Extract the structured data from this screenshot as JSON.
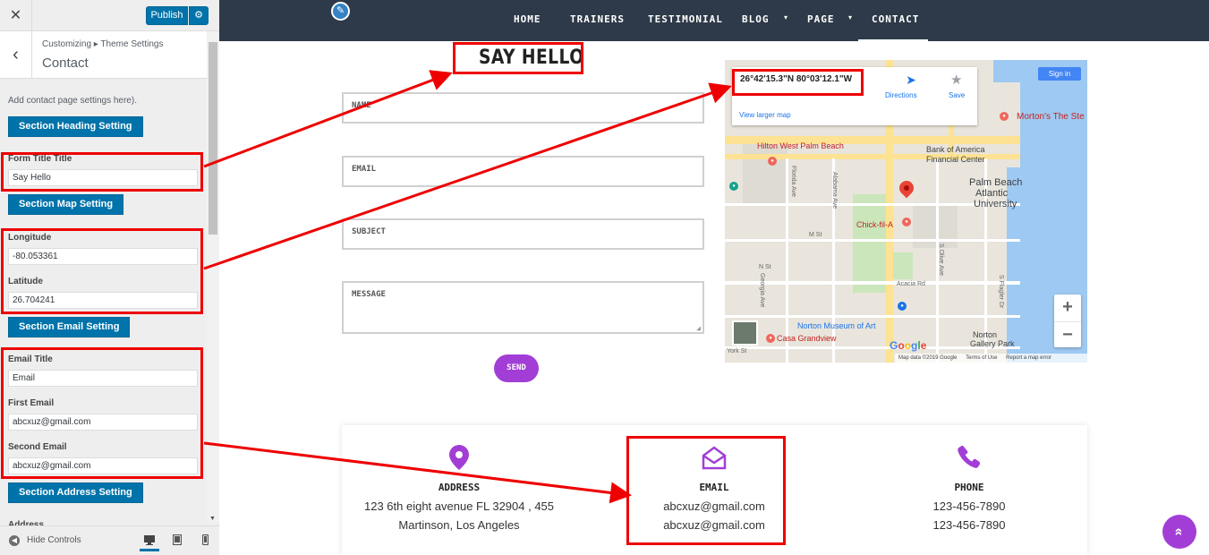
{
  "customizer": {
    "close_icon": "✕",
    "publish_label": "Publish",
    "gear_icon": "⚙",
    "back_icon": "‹",
    "breadcrumb": "Customizing ▸ Theme Settings",
    "section_title": "Contact",
    "description": "Add contact page settings here).",
    "heading_btn": "Section Heading Setting",
    "form_title_label": "Form Title Title",
    "form_title_value": "Say Hello",
    "map_btn": "Section Map Setting",
    "longitude_label": "Longitude",
    "longitude_value": "-80.053361",
    "latitude_label": "Latitude",
    "latitude_value": "26.704241",
    "email_btn": "Section Email Setting",
    "email_title_label": "Email Title",
    "email_title_value": "Email",
    "first_email_label": "First Email",
    "first_email_value": "abcxuz@gmail.com",
    "second_email_label": "Second Email",
    "second_email_value": "abcxuz@gmail.com",
    "address_btn": "Section Address Setting",
    "address_label_cut": "Address",
    "hide_controls": "Hide Controls"
  },
  "nav": {
    "pencil_icon": "✎",
    "items": [
      "HOME",
      "TRAINERS",
      "TESTIMONIAL",
      "BLOG",
      "PAGE",
      "CONTACT"
    ],
    "caret": "▾"
  },
  "form": {
    "title": "SAY HELLO",
    "name_placeholder": "NAME",
    "email_placeholder": "EMAIL",
    "subject_placeholder": "SUBJECT",
    "message_placeholder": "MESSAGE",
    "send_label": "SEND"
  },
  "map": {
    "coords": "26°42'15.3\"N 80°03'12.1\"W",
    "directions": "Directions",
    "save": "Save",
    "view_larger": "View larger map",
    "sign_in": "Sign in",
    "labels": {
      "mortons": "Morton's The Ste",
      "hilton": "Hilton West Palm Beach",
      "bank": "Bank of America",
      "bank2": "Financial Center",
      "pba1": "Palm Beach",
      "pba2": "Atlantic",
      "pba3": "University",
      "chick": "Chick-fil-A",
      "norton": "Norton Museum of Art",
      "norton_gallery1": "Norton",
      "norton_gallery2": "Gallery Park",
      "casa": "Casa Grandview",
      "m_st": "M St",
      "n_st": "N St",
      "acacia": "Acacia Rd",
      "york": "York St",
      "florida": "Florida Ave",
      "alabama": "Alabama Ave",
      "olive": "S Olive Ave",
      "flagler": "S Flagler Dr",
      "georgia": "Georgia Ave"
    },
    "zoom_in": "+",
    "zoom_out": "−",
    "google": "Google",
    "footer_data": "Map data ©2019 Google",
    "footer_terms": "Terms of Use",
    "footer_report": "Report a map error"
  },
  "contact_info": {
    "address": {
      "icon": "map-pin-icon",
      "title": "ADDRESS",
      "line1": "123 6th eight avenue FL 32904 , 455",
      "line2": "Martinson, Los Angeles"
    },
    "email": {
      "icon": "envelope-open-icon",
      "title": "EMAIL",
      "line1": "abcxuz@gmail.com",
      "line2": "abcxuz@gmail.com"
    },
    "phone": {
      "icon": "phone-icon",
      "title": "PHONE",
      "line1": "123-456-7890",
      "line2": "123-456-7890"
    }
  },
  "scroll_top_icon": "»",
  "colors": {
    "accent": "#a23ed6",
    "nav_bg": "#2e3a49",
    "wp_blue": "#0073aa",
    "annotation_red": "#ee0000"
  }
}
